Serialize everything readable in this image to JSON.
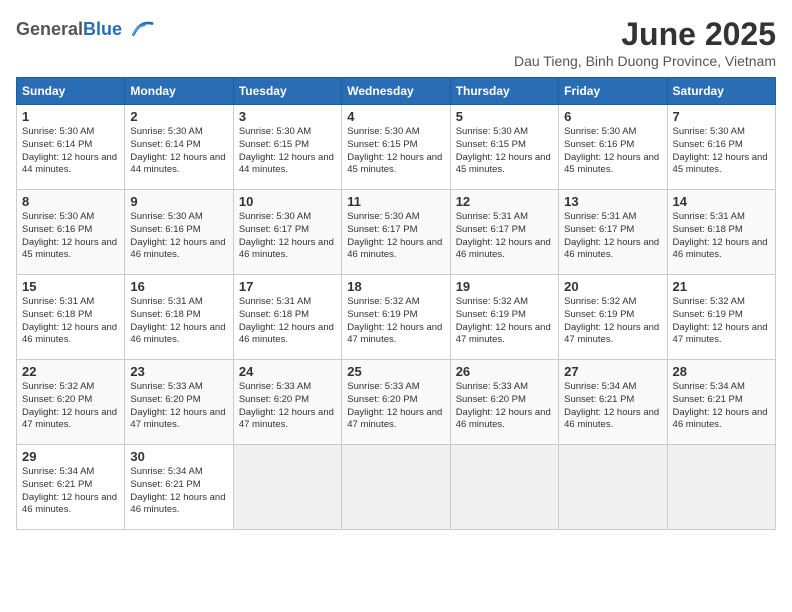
{
  "logo": {
    "general": "General",
    "blue": "Blue"
  },
  "header": {
    "title": "June 2025",
    "subtitle": "Dau Tieng, Binh Duong Province, Vietnam"
  },
  "weekdays": [
    "Sunday",
    "Monday",
    "Tuesday",
    "Wednesday",
    "Thursday",
    "Friday",
    "Saturday"
  ],
  "weeks": [
    [
      {
        "day": "1",
        "sunrise": "5:30 AM",
        "sunset": "6:14 PM",
        "daylight": "12 hours and 44 minutes."
      },
      {
        "day": "2",
        "sunrise": "5:30 AM",
        "sunset": "6:14 PM",
        "daylight": "12 hours and 44 minutes."
      },
      {
        "day": "3",
        "sunrise": "5:30 AM",
        "sunset": "6:15 PM",
        "daylight": "12 hours and 44 minutes."
      },
      {
        "day": "4",
        "sunrise": "5:30 AM",
        "sunset": "6:15 PM",
        "daylight": "12 hours and 45 minutes."
      },
      {
        "day": "5",
        "sunrise": "5:30 AM",
        "sunset": "6:15 PM",
        "daylight": "12 hours and 45 minutes."
      },
      {
        "day": "6",
        "sunrise": "5:30 AM",
        "sunset": "6:16 PM",
        "daylight": "12 hours and 45 minutes."
      },
      {
        "day": "7",
        "sunrise": "5:30 AM",
        "sunset": "6:16 PM",
        "daylight": "12 hours and 45 minutes."
      }
    ],
    [
      {
        "day": "8",
        "sunrise": "5:30 AM",
        "sunset": "6:16 PM",
        "daylight": "12 hours and 45 minutes."
      },
      {
        "day": "9",
        "sunrise": "5:30 AM",
        "sunset": "6:16 PM",
        "daylight": "12 hours and 46 minutes."
      },
      {
        "day": "10",
        "sunrise": "5:30 AM",
        "sunset": "6:17 PM",
        "daylight": "12 hours and 46 minutes."
      },
      {
        "day": "11",
        "sunrise": "5:30 AM",
        "sunset": "6:17 PM",
        "daylight": "12 hours and 46 minutes."
      },
      {
        "day": "12",
        "sunrise": "5:31 AM",
        "sunset": "6:17 PM",
        "daylight": "12 hours and 46 minutes."
      },
      {
        "day": "13",
        "sunrise": "5:31 AM",
        "sunset": "6:17 PM",
        "daylight": "12 hours and 46 minutes."
      },
      {
        "day": "14",
        "sunrise": "5:31 AM",
        "sunset": "6:18 PM",
        "daylight": "12 hours and 46 minutes."
      }
    ],
    [
      {
        "day": "15",
        "sunrise": "5:31 AM",
        "sunset": "6:18 PM",
        "daylight": "12 hours and 46 minutes."
      },
      {
        "day": "16",
        "sunrise": "5:31 AM",
        "sunset": "6:18 PM",
        "daylight": "12 hours and 46 minutes."
      },
      {
        "day": "17",
        "sunrise": "5:31 AM",
        "sunset": "6:18 PM",
        "daylight": "12 hours and 46 minutes."
      },
      {
        "day": "18",
        "sunrise": "5:32 AM",
        "sunset": "6:19 PM",
        "daylight": "12 hours and 47 minutes."
      },
      {
        "day": "19",
        "sunrise": "5:32 AM",
        "sunset": "6:19 PM",
        "daylight": "12 hours and 47 minutes."
      },
      {
        "day": "20",
        "sunrise": "5:32 AM",
        "sunset": "6:19 PM",
        "daylight": "12 hours and 47 minutes."
      },
      {
        "day": "21",
        "sunrise": "5:32 AM",
        "sunset": "6:19 PM",
        "daylight": "12 hours and 47 minutes."
      }
    ],
    [
      {
        "day": "22",
        "sunrise": "5:32 AM",
        "sunset": "6:20 PM",
        "daylight": "12 hours and 47 minutes."
      },
      {
        "day": "23",
        "sunrise": "5:33 AM",
        "sunset": "6:20 PM",
        "daylight": "12 hours and 47 minutes."
      },
      {
        "day": "24",
        "sunrise": "5:33 AM",
        "sunset": "6:20 PM",
        "daylight": "12 hours and 47 minutes."
      },
      {
        "day": "25",
        "sunrise": "5:33 AM",
        "sunset": "6:20 PM",
        "daylight": "12 hours and 47 minutes."
      },
      {
        "day": "26",
        "sunrise": "5:33 AM",
        "sunset": "6:20 PM",
        "daylight": "12 hours and 46 minutes."
      },
      {
        "day": "27",
        "sunrise": "5:34 AM",
        "sunset": "6:21 PM",
        "daylight": "12 hours and 46 minutes."
      },
      {
        "day": "28",
        "sunrise": "5:34 AM",
        "sunset": "6:21 PM",
        "daylight": "12 hours and 46 minutes."
      }
    ],
    [
      {
        "day": "29",
        "sunrise": "5:34 AM",
        "sunset": "6:21 PM",
        "daylight": "12 hours and 46 minutes."
      },
      {
        "day": "30",
        "sunrise": "5:34 AM",
        "sunset": "6:21 PM",
        "daylight": "12 hours and 46 minutes."
      },
      null,
      null,
      null,
      null,
      null
    ]
  ]
}
